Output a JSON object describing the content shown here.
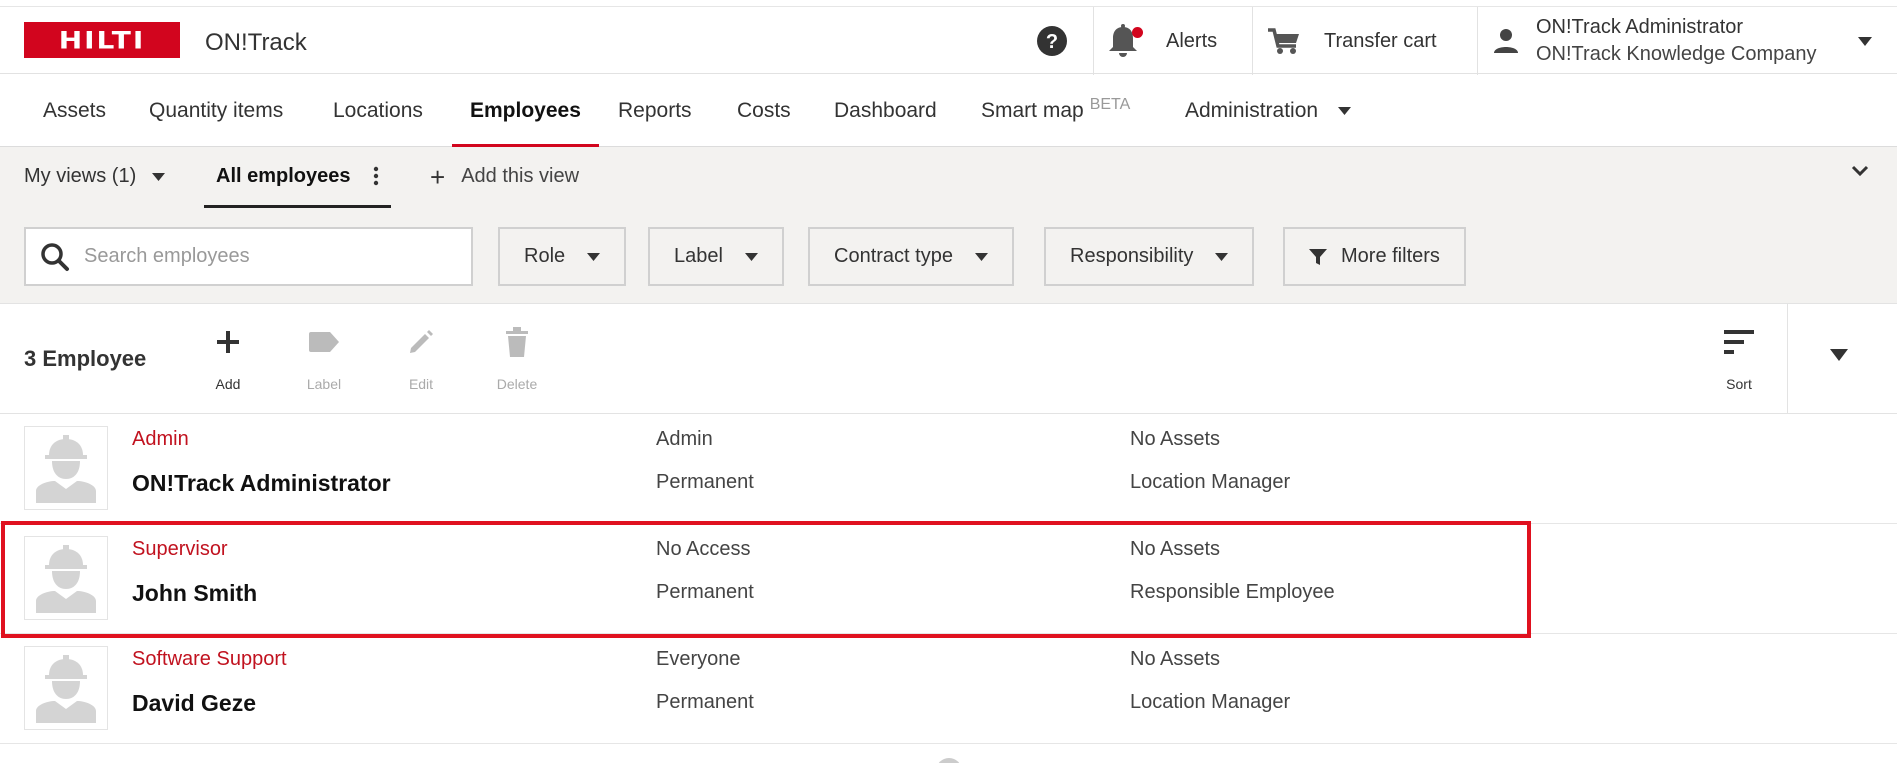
{
  "header": {
    "logo_text": "HILTI",
    "app_name": "ON!Track",
    "alerts_label": "Alerts",
    "cart_label": "Transfer cart",
    "user_name": "ON!Track Administrator",
    "company": "ON!Track Knowledge Company",
    "brand_color": "#d2051e"
  },
  "nav": {
    "tabs": [
      {
        "label": "Assets"
      },
      {
        "label": "Quantity items"
      },
      {
        "label": "Locations"
      },
      {
        "label": "Employees",
        "active": true
      },
      {
        "label": "Reports"
      },
      {
        "label": "Costs"
      },
      {
        "label": "Dashboard"
      },
      {
        "label": "Smart map",
        "badge": "BETA"
      },
      {
        "label": "Administration"
      }
    ]
  },
  "views": {
    "my_views": "My views (1)",
    "current_view": "All employees",
    "add_view": "Add this view"
  },
  "filters": {
    "search_placeholder": "Search employees",
    "role": "Role",
    "label": "Label",
    "contract_type": "Contract type",
    "responsibility": "Responsibility",
    "more_filters": "More filters"
  },
  "toolbar": {
    "count": "3 Employee",
    "add": "Add",
    "label": "Label",
    "edit": "Edit",
    "delete": "Delete",
    "sort": "Sort"
  },
  "employees": [
    {
      "role": "Admin",
      "name": "ON!Track Administrator",
      "access": "Admin",
      "contract": "Permanent",
      "assets": "No Assets",
      "responsibility": "Location Manager"
    },
    {
      "role": "Supervisor",
      "name": "John Smith",
      "access": "No Access",
      "contract": "Permanent",
      "assets": "No Assets",
      "responsibility": "Responsible Employee",
      "highlighted": true
    },
    {
      "role": "Software Support",
      "name": "David Geze",
      "access": "Everyone",
      "contract": "Permanent",
      "assets": "No Assets",
      "responsibility": "Location Manager"
    }
  ]
}
